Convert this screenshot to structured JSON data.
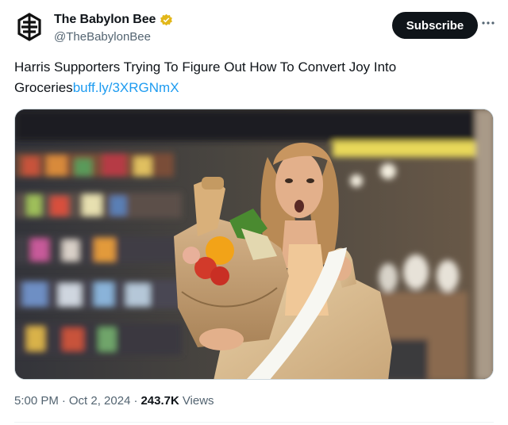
{
  "account": {
    "display_name": "The Babylon Bee",
    "handle": "@TheBabylonBee",
    "verified": true
  },
  "actions": {
    "subscribe_label": "Subscribe",
    "more_icon": "more-horizontal-icon"
  },
  "tweet": {
    "text": "Harris Supporters Trying To Figure Out How To Convert Joy Into Groceries",
    "link": "buff.ly/3XRGNmX"
  },
  "meta": {
    "time": "5:00 PM",
    "separator": "·",
    "date": "Oct 2, 2024",
    "views_count": "243.7K",
    "views_label": "Views"
  },
  "colors": {
    "brand_gold": "#f2b51c",
    "link_blue": "#1d9bf0",
    "button_dark": "#0f1419",
    "muted_text": "#536471"
  }
}
